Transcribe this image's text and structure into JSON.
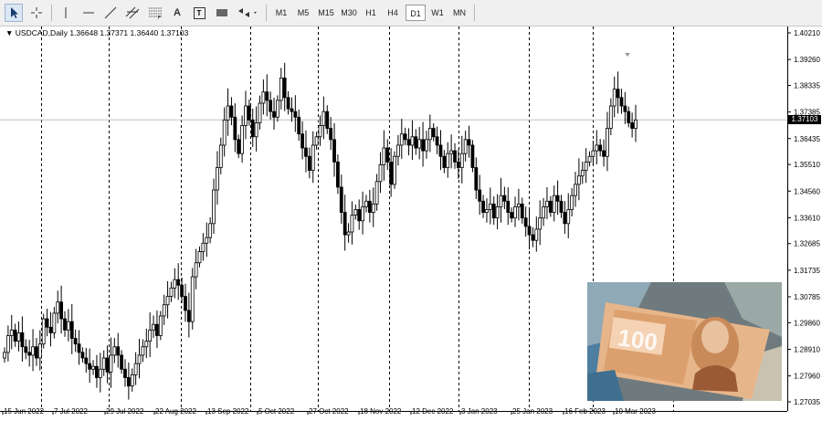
{
  "toolbar": {
    "tools": [
      {
        "name": "cursor-tool-icon"
      },
      {
        "name": "crosshair-tool-icon"
      },
      {
        "name": "vertical-line-tool-icon"
      },
      {
        "name": "horizontal-line-tool-icon"
      },
      {
        "name": "trend-line-tool-icon"
      },
      {
        "name": "channels-tool-icon"
      },
      {
        "name": "fibonacci-tool-icon"
      },
      {
        "name": "text-tool-icon"
      },
      {
        "name": "text-label-tool-icon"
      },
      {
        "name": "rectangle-tool-icon"
      },
      {
        "name": "arrows-tool-icon"
      }
    ],
    "text_tool_label": "A",
    "text_label_tool_label": "T",
    "timeframes": [
      "M1",
      "M5",
      "M15",
      "M30",
      "H1",
      "H4",
      "D1",
      "W1",
      "MN"
    ],
    "active_timeframe": "D1"
  },
  "chart": {
    "symbol_period": "USDCAD,Daily",
    "ohlc": "1.36648 1.37371 1.36440 1.37103",
    "current_price": "1.37103",
    "colors": {
      "candle": "#000000",
      "grid": "#000000",
      "price_line": "#c0c0c0",
      "background": "#ffffff"
    }
  },
  "chart_data": {
    "type": "candlestick",
    "symbol": "USDCAD",
    "period": "Daily",
    "last_bar": {
      "open": 1.36648,
      "high": 1.37371,
      "low": 1.3644,
      "close": 1.37103
    },
    "ylim": [
      1.26925,
      1.40493
    ],
    "y_ticks": [
      "1.40210",
      "1.39260",
      "1.38335",
      "1.37385",
      "1.36435",
      "1.35510",
      "1.34560",
      "1.33610",
      "1.32685",
      "1.31735",
      "1.30785",
      "1.29860",
      "1.28910",
      "1.27960",
      "1.27035"
    ],
    "x_ticks": [
      "15 Jun 2022",
      "7 Jul 2022",
      "29 Jul 2022",
      "22 Aug 2022",
      "13 Sep 2022",
      "5 Oct 2022",
      "27 Oct 2022",
      "18 Nov 2022",
      "12 Dec 2022",
      "3 Jan 2023",
      "25 Jan 2023",
      "16 Feb 2023",
      "10 Mar 2023"
    ],
    "close_series": [
      1.288,
      1.294,
      1.296,
      1.292,
      1.295,
      1.29,
      1.288,
      1.287,
      1.29,
      1.286,
      1.291,
      1.3,
      1.297,
      1.295,
      1.302,
      1.306,
      1.3,
      1.296,
      1.299,
      1.293,
      1.291,
      1.288,
      1.286,
      1.284,
      1.282,
      1.283,
      1.279,
      1.282,
      1.286,
      1.281,
      1.287,
      1.29,
      1.287,
      1.282,
      1.279,
      1.276,
      1.28,
      1.284,
      1.287,
      1.29,
      1.292,
      1.296,
      1.298,
      1.294,
      1.301,
      1.305,
      1.308,
      1.311,
      1.314,
      1.312,
      1.308,
      1.303,
      1.299,
      1.315,
      1.32,
      1.324,
      1.327,
      1.329,
      1.334,
      1.346,
      1.354,
      1.362,
      1.371,
      1.376,
      1.372,
      1.364,
      1.359,
      1.369,
      1.376,
      1.371,
      1.365,
      1.37,
      1.377,
      1.381,
      1.378,
      1.374,
      1.372,
      1.378,
      1.386,
      1.379,
      1.375,
      1.374,
      1.372,
      1.366,
      1.361,
      1.358,
      1.353,
      1.362,
      1.365,
      1.369,
      1.374,
      1.368,
      1.364,
      1.356,
      1.347,
      1.338,
      1.33,
      1.331,
      1.337,
      1.339,
      1.335,
      1.34,
      1.342,
      1.338,
      1.341,
      1.349,
      1.355,
      1.361,
      1.356,
      1.348,
      1.358,
      1.362,
      1.366,
      1.364,
      1.362,
      1.365,
      1.361,
      1.364,
      1.36,
      1.364,
      1.368,
      1.365,
      1.362,
      1.358,
      1.354,
      1.359,
      1.36,
      1.356,
      1.354,
      1.359,
      1.364,
      1.362,
      1.354,
      1.346,
      1.342,
      1.338,
      1.339,
      1.341,
      1.336,
      1.34,
      1.344,
      1.342,
      1.338,
      1.336,
      1.34,
      1.341,
      1.336,
      1.333,
      1.33,
      1.328,
      1.332,
      1.336,
      1.34,
      1.342,
      1.338,
      1.344,
      1.342,
      1.338,
      1.334,
      1.339,
      1.344,
      1.348,
      1.351,
      1.353,
      1.356,
      1.358,
      1.36,
      1.362,
      1.36,
      1.358,
      1.368,
      1.376,
      1.382,
      1.379,
      1.376,
      1.374,
      1.37,
      1.368,
      1.371
    ]
  }
}
